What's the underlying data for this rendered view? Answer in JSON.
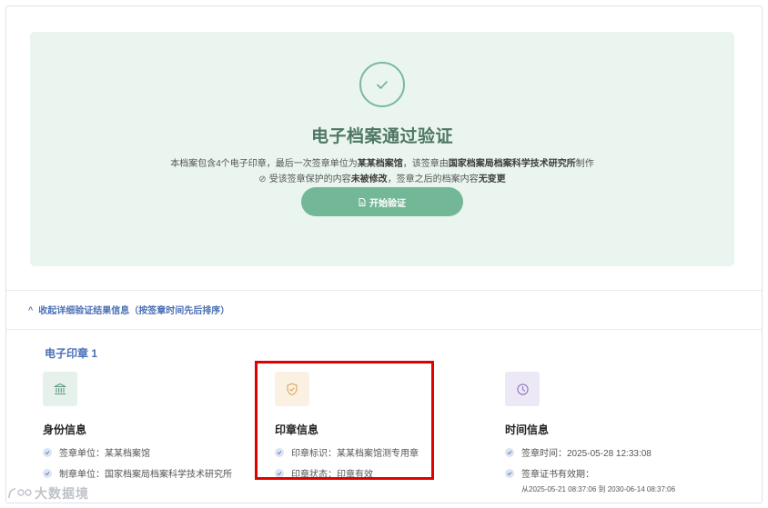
{
  "result": {
    "title": "电子档案通过验证",
    "desc_prefix": "本档案包含4个电子印章，最后一次签章单位为",
    "desc_unit": "某某档案馆",
    "desc_mid": "，该签章由",
    "desc_maker": "国家档案局档案科学技术研究所",
    "desc_suffix": "制作",
    "note_prefix": "受该签章保护的内容",
    "note_bold1": "未被修改",
    "note_mid": "，签章之后的档案内容",
    "note_bold2": "无变更",
    "verify_button": "开始验证"
  },
  "details": {
    "toggle_label": "收起详细验证结果信息（按签章时间先后排序）",
    "seal_title": "电子印章 1"
  },
  "columns": {
    "identity": {
      "heading": "身份信息",
      "rows": [
        "签章单位：某某档案馆",
        "制章单位：国家档案局档案科学技术研究所"
      ]
    },
    "seal": {
      "heading": "印章信息",
      "rows": [
        "印章标识：某某档案馆测专用章",
        "印章状态：印章有效"
      ]
    },
    "time": {
      "heading": "时间信息",
      "rows": [
        "签章时间：2025-05-28 12:33:08",
        "签章证书有效期："
      ],
      "validity": "从2025-05-21 08:37:06 到 2030-06-14 08:37:06"
    }
  },
  "watermark": "大数据境",
  "colors": {
    "success_green": "#72b897",
    "card_bg": "#eaf5ef",
    "link_blue": "#4a6fb5",
    "highlight_red": "#e00000"
  },
  "icons": {
    "result": "check-circle-icon",
    "verify": "document-icon",
    "identity": "institution-icon",
    "seal": "shield-check-icon",
    "time": "clock-icon",
    "row": "check-circle-small-icon"
  }
}
